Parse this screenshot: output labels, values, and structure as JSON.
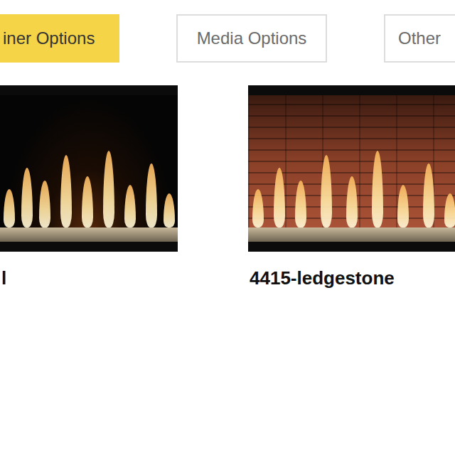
{
  "tabs": [
    {
      "label": "iner Options",
      "selected": true
    },
    {
      "label": "Media Options",
      "selected": false
    },
    {
      "label": "Other",
      "selected": false
    }
  ],
  "tiles": [
    {
      "caption": "l",
      "kind": "glass"
    },
    {
      "caption": "4415-ledgestone",
      "kind": "ledgestone"
    }
  ]
}
